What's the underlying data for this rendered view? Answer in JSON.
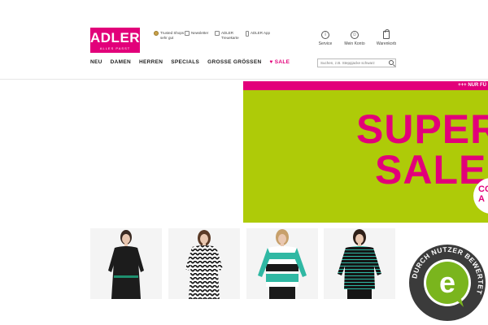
{
  "brand": {
    "name": "ADLER",
    "claim": "ALLES PASST",
    "color": "#e2007a"
  },
  "usps": [
    {
      "icon": "trusted-shops-seal-icon",
      "line1": "Trusted Shops",
      "line2": "sehr gut"
    },
    {
      "icon": "newsletter-icon",
      "line1": "Newsletter",
      "line2": ""
    },
    {
      "icon": "card-icon",
      "line1": "ADLER",
      "line2": "Treuekarte"
    },
    {
      "icon": "phone-icon",
      "line1": "ADLER App",
      "line2": ""
    }
  ],
  "service_nav": [
    {
      "icon": "info-icon",
      "label": "Service"
    },
    {
      "icon": "user-icon",
      "label": "Mein Konto"
    },
    {
      "icon": "shopping-bag-icon",
      "label": "Warenkorb"
    }
  ],
  "nav": {
    "items": [
      "NEU",
      "DAMEN",
      "HERREN",
      "SPECIALS",
      "GROSSE GRÖSSEN"
    ],
    "sale_label": "♥ SALE"
  },
  "search": {
    "placeholder": "Suchen, z.B. Steppjacke schwarz"
  },
  "hero": {
    "stripe_text": "+++ NUR FÜ",
    "headline_1": "SUPER",
    "headline_2": "SALE",
    "bubble_line1": "CO",
    "bubble_line2": "A",
    "bg_color": "#aecb08",
    "accent_color": "#e2007a"
  },
  "products": [
    {
      "image": "black-knit-dress-with-belt"
    },
    {
      "image": "zigzag-black-white-dress"
    },
    {
      "image": "teal-black-striped-sweater"
    },
    {
      "image": "black-teal-pinstripe-sweater"
    }
  ],
  "rating_badge": {
    "ring_text": "DURCH NUTZER BEWERTET",
    "letter": "e",
    "ring_color": "#3b3b3b",
    "accent_color": "#7ab51d"
  }
}
